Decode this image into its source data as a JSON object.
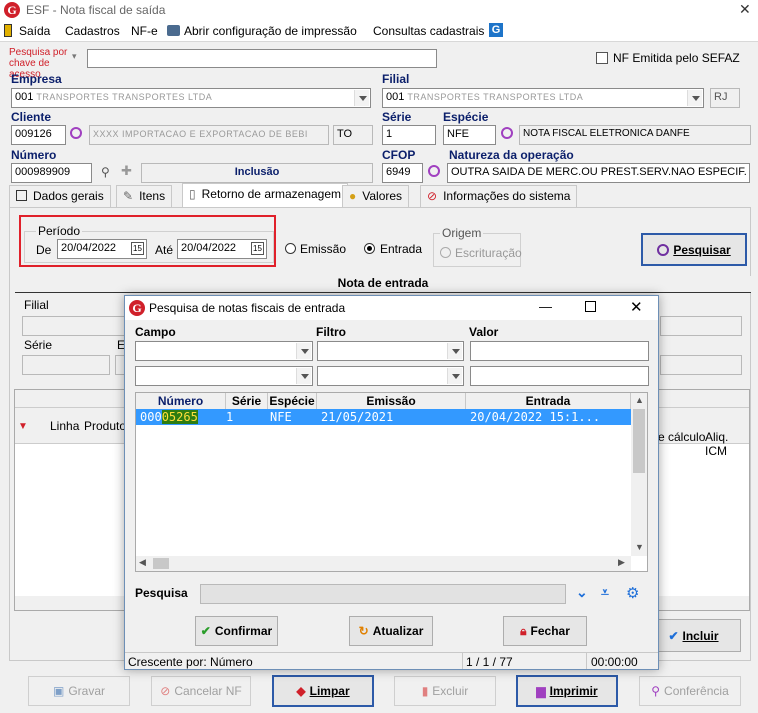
{
  "window": {
    "title": "ESF - Nota fiscal de saída",
    "close": "✕"
  },
  "menu": {
    "saida": "Saída",
    "cadastros": "Cadastros",
    "nfe": "NF-e",
    "abrir_config": "Abrir configuração de impressão",
    "consultas": "Consultas cadastrais"
  },
  "search_key": {
    "label": "Pesquisa por chave de acesso",
    "value": ""
  },
  "nf_sefaz": {
    "label": "NF Emitida pelo SEFAZ"
  },
  "empresa": {
    "label": "Empresa",
    "code": "001",
    "name": "TRANSPORTES TRANSPORTES LTDA"
  },
  "filial": {
    "label": "Filial",
    "code": "001",
    "name": "TRANSPORTES TRANSPORTES LTDA",
    "uf": "RJ"
  },
  "cliente": {
    "label": "Cliente",
    "code": "009126",
    "name": "XXXX IMPORTACAO E EXPORTACAO DE BEBI",
    "uf": "TO"
  },
  "serie": {
    "label": "Série",
    "value": "1"
  },
  "especie": {
    "label": "Espécie",
    "code": "NFE",
    "desc": "NOTA FISCAL ELETRONICA DANFE"
  },
  "numero": {
    "label": "Número",
    "value": "000989909",
    "status": "Inclusão"
  },
  "cfop": {
    "label": "CFOP",
    "value": "6949"
  },
  "natureza": {
    "label": "Natureza da operação",
    "value": "OUTRA SAIDA DE MERC.OU PREST.SERV.NAO ESPECIF."
  },
  "tabs": [
    "Dados gerais",
    "Itens",
    "Retorno de armazenagem",
    "Valores",
    "Informações do sistema"
  ],
  "periodo": {
    "legend": "Período",
    "de": "De",
    "de_value": "20/04/2022",
    "ate": "Até",
    "ate_value": "20/04/2022",
    "emissao": "Emissão",
    "entrada": "Entrada"
  },
  "origem": {
    "legend": "Origem",
    "escrituracao": "Escrituração"
  },
  "pesquisar": "Pesquisar",
  "nota_entrada": {
    "title": "Nota de entrada",
    "filial": "Filial",
    "serie": "Série"
  },
  "items_grid": {
    "linha": "Linha",
    "produto": "Produto",
    "base_calculo": "e cálculo",
    "aliq": "Aliq. ICM"
  },
  "incluir": "Incluir",
  "bottom": {
    "gravar": "Gravar",
    "cancelar": "Cancelar NF",
    "limpar": "Limpar",
    "excluir": "Excluir",
    "imprimir": "Imprimir",
    "conferencia": "Conferência"
  },
  "dialog": {
    "title": "Pesquisa de notas fiscais de entrada",
    "campo": "Campo",
    "filtro": "Filtro",
    "valor": "Valor",
    "columns": [
      "Número",
      "Série",
      "Espécie",
      "Emissão",
      "Entrada"
    ],
    "row": {
      "numero_prefix": "000",
      "numero_match": "05265",
      "serie": "1",
      "especie": "NFE",
      "emissao": "21/05/2021",
      "entrada": "20/04/2022 15:1..."
    },
    "pesquisa": "Pesquisa",
    "confirmar": "Confirmar",
    "atualizar": "Atualizar",
    "fechar": "Fechar",
    "status_order": "Crescente por: Número",
    "status_pos": "1 / 1 / 77",
    "status_time": "00:00:00"
  },
  "colors": {
    "accent": "#0b1f6b",
    "selection": "#3399ff",
    "highlight_red": "#e0202a"
  }
}
